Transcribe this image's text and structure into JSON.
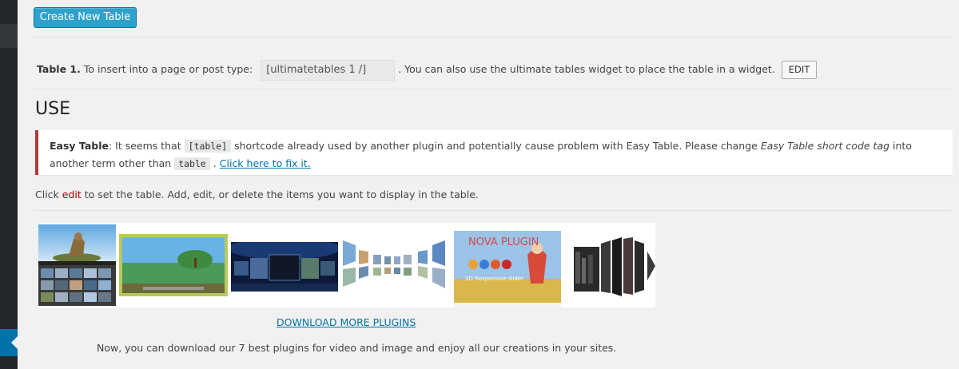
{
  "toolbar": {
    "create_label": "Create New Table"
  },
  "table_info": {
    "table_label": "Table 1.",
    "instruction_prefix": "To insert into a page or post type:",
    "shortcode_value": "[ultimatetables 1 /]",
    "instruction_suffix": ". You can also use the ultimate tables widget to place the table in a widget.",
    "edit_label": "EDIT"
  },
  "use_section": {
    "heading": "USE",
    "notice": {
      "title": "Easy Table",
      "text_1": ": It seems that",
      "code_1": "[table]",
      "text_2": "shortcode already used by another plugin and potentially cause problem with Easy Table. Please change",
      "emphasis": "Easy Table short code tag",
      "text_3": "into another term other than",
      "code_2": "table",
      "text_4": ".",
      "fix_link": "Click here to fix it."
    },
    "instructions": {
      "prefix": "Click",
      "edit_word": "edit",
      "suffix": "to set the table. Add, edit, or delete the items you want to display in the table."
    }
  },
  "plugins": {
    "thumbnail_text": {
      "nova_title": "NOVA PLUGIN",
      "nova_sub": "3D Responsive slider"
    },
    "download_link": "DOWNLOAD MORE PLUGINS",
    "description": "Now, you can download our 7 best plugins for video and image and enjoy all our creations in your sites."
  },
  "colors": {
    "primary_button": "#2ea2cc",
    "link": "#0073aa",
    "notice_border": "#b33a3a",
    "sidebar": "#23282d"
  }
}
